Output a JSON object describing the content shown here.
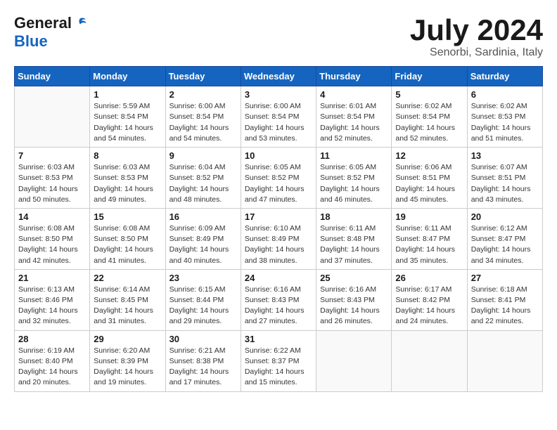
{
  "header": {
    "logo_general": "General",
    "logo_blue": "Blue",
    "month_title": "July 2024",
    "location": "Senorbi, Sardinia, Italy"
  },
  "days_of_week": [
    "Sunday",
    "Monday",
    "Tuesday",
    "Wednesday",
    "Thursday",
    "Friday",
    "Saturday"
  ],
  "weeks": [
    [
      {
        "day": "",
        "info": ""
      },
      {
        "day": "1",
        "info": "Sunrise: 5:59 AM\nSunset: 8:54 PM\nDaylight: 14 hours\nand 54 minutes."
      },
      {
        "day": "2",
        "info": "Sunrise: 6:00 AM\nSunset: 8:54 PM\nDaylight: 14 hours\nand 54 minutes."
      },
      {
        "day": "3",
        "info": "Sunrise: 6:00 AM\nSunset: 8:54 PM\nDaylight: 14 hours\nand 53 minutes."
      },
      {
        "day": "4",
        "info": "Sunrise: 6:01 AM\nSunset: 8:54 PM\nDaylight: 14 hours\nand 52 minutes."
      },
      {
        "day": "5",
        "info": "Sunrise: 6:02 AM\nSunset: 8:54 PM\nDaylight: 14 hours\nand 52 minutes."
      },
      {
        "day": "6",
        "info": "Sunrise: 6:02 AM\nSunset: 8:53 PM\nDaylight: 14 hours\nand 51 minutes."
      }
    ],
    [
      {
        "day": "7",
        "info": "Sunrise: 6:03 AM\nSunset: 8:53 PM\nDaylight: 14 hours\nand 50 minutes."
      },
      {
        "day": "8",
        "info": "Sunrise: 6:03 AM\nSunset: 8:53 PM\nDaylight: 14 hours\nand 49 minutes."
      },
      {
        "day": "9",
        "info": "Sunrise: 6:04 AM\nSunset: 8:52 PM\nDaylight: 14 hours\nand 48 minutes."
      },
      {
        "day": "10",
        "info": "Sunrise: 6:05 AM\nSunset: 8:52 PM\nDaylight: 14 hours\nand 47 minutes."
      },
      {
        "day": "11",
        "info": "Sunrise: 6:05 AM\nSunset: 8:52 PM\nDaylight: 14 hours\nand 46 minutes."
      },
      {
        "day": "12",
        "info": "Sunrise: 6:06 AM\nSunset: 8:51 PM\nDaylight: 14 hours\nand 45 minutes."
      },
      {
        "day": "13",
        "info": "Sunrise: 6:07 AM\nSunset: 8:51 PM\nDaylight: 14 hours\nand 43 minutes."
      }
    ],
    [
      {
        "day": "14",
        "info": "Sunrise: 6:08 AM\nSunset: 8:50 PM\nDaylight: 14 hours\nand 42 minutes."
      },
      {
        "day": "15",
        "info": "Sunrise: 6:08 AM\nSunset: 8:50 PM\nDaylight: 14 hours\nand 41 minutes."
      },
      {
        "day": "16",
        "info": "Sunrise: 6:09 AM\nSunset: 8:49 PM\nDaylight: 14 hours\nand 40 minutes."
      },
      {
        "day": "17",
        "info": "Sunrise: 6:10 AM\nSunset: 8:49 PM\nDaylight: 14 hours\nand 38 minutes."
      },
      {
        "day": "18",
        "info": "Sunrise: 6:11 AM\nSunset: 8:48 PM\nDaylight: 14 hours\nand 37 minutes."
      },
      {
        "day": "19",
        "info": "Sunrise: 6:11 AM\nSunset: 8:47 PM\nDaylight: 14 hours\nand 35 minutes."
      },
      {
        "day": "20",
        "info": "Sunrise: 6:12 AM\nSunset: 8:47 PM\nDaylight: 14 hours\nand 34 minutes."
      }
    ],
    [
      {
        "day": "21",
        "info": "Sunrise: 6:13 AM\nSunset: 8:46 PM\nDaylight: 14 hours\nand 32 minutes."
      },
      {
        "day": "22",
        "info": "Sunrise: 6:14 AM\nSunset: 8:45 PM\nDaylight: 14 hours\nand 31 minutes."
      },
      {
        "day": "23",
        "info": "Sunrise: 6:15 AM\nSunset: 8:44 PM\nDaylight: 14 hours\nand 29 minutes."
      },
      {
        "day": "24",
        "info": "Sunrise: 6:16 AM\nSunset: 8:43 PM\nDaylight: 14 hours\nand 27 minutes."
      },
      {
        "day": "25",
        "info": "Sunrise: 6:16 AM\nSunset: 8:43 PM\nDaylight: 14 hours\nand 26 minutes."
      },
      {
        "day": "26",
        "info": "Sunrise: 6:17 AM\nSunset: 8:42 PM\nDaylight: 14 hours\nand 24 minutes."
      },
      {
        "day": "27",
        "info": "Sunrise: 6:18 AM\nSunset: 8:41 PM\nDaylight: 14 hours\nand 22 minutes."
      }
    ],
    [
      {
        "day": "28",
        "info": "Sunrise: 6:19 AM\nSunset: 8:40 PM\nDaylight: 14 hours\nand 20 minutes."
      },
      {
        "day": "29",
        "info": "Sunrise: 6:20 AM\nSunset: 8:39 PM\nDaylight: 14 hours\nand 19 minutes."
      },
      {
        "day": "30",
        "info": "Sunrise: 6:21 AM\nSunset: 8:38 PM\nDaylight: 14 hours\nand 17 minutes."
      },
      {
        "day": "31",
        "info": "Sunrise: 6:22 AM\nSunset: 8:37 PM\nDaylight: 14 hours\nand 15 minutes."
      },
      {
        "day": "",
        "info": ""
      },
      {
        "day": "",
        "info": ""
      },
      {
        "day": "",
        "info": ""
      }
    ]
  ]
}
